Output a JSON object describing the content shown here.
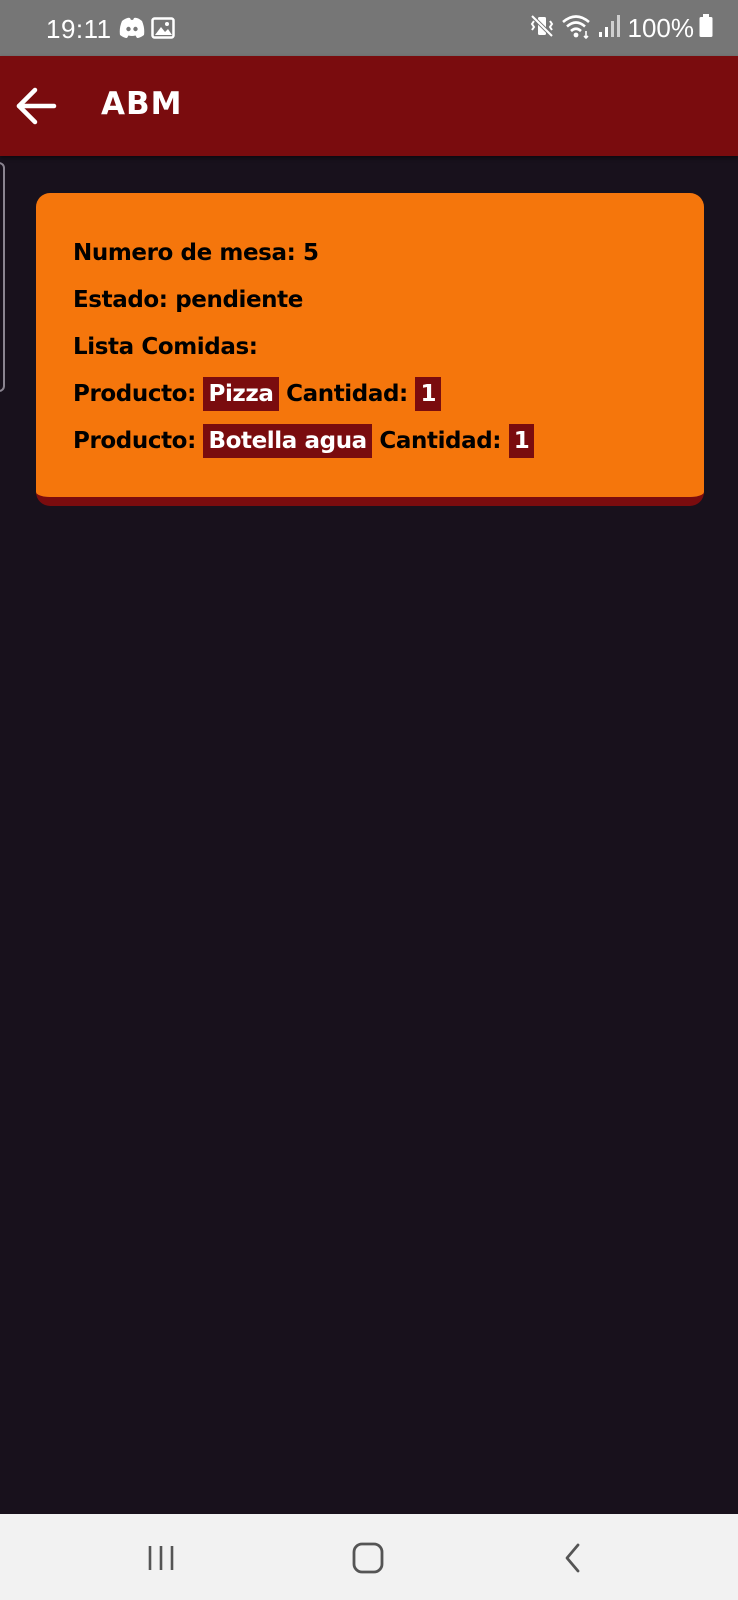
{
  "status_bar": {
    "time": "19:11",
    "left_icons": [
      "discord-icon",
      "image-icon"
    ],
    "right_icons": [
      "mute-vibrate-icon",
      "wifi-icon",
      "signal-icon",
      "battery-icon"
    ],
    "battery_percent": "100%"
  },
  "app_bar": {
    "back_icon": "arrow-left-icon",
    "title": "ABM",
    "color": "#7a0c0e"
  },
  "order": {
    "table_label": "Numero de mesa:",
    "table_number": "5",
    "status_label": "Estado:",
    "status_value": "pendiente",
    "food_list_label": "Lista Comidas:",
    "items": [
      {
        "product_label": "Producto:",
        "product": "Pizza",
        "quantity_label": "Cantidad:",
        "quantity": "1"
      },
      {
        "product_label": "Producto:",
        "product": "Botella agua",
        "quantity_label": "Cantidad:",
        "quantity": "1"
      }
    ],
    "card_color": "#f5760c",
    "chip_color": "#7a0c0e"
  },
  "nav_bar": {
    "buttons": [
      "recents-icon",
      "home-icon",
      "back-chevron-icon"
    ]
  }
}
